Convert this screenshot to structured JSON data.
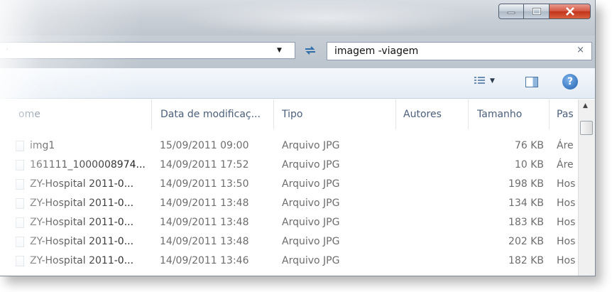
{
  "window": {
    "controls": {
      "minimize": "minimize",
      "maximize": "maximize",
      "close": "close"
    }
  },
  "address": {
    "chevron": "›",
    "dropdown": "▼"
  },
  "search": {
    "value": "imagem -viagem",
    "clear": "×"
  },
  "toolbar": {
    "views_icon": "views-icon",
    "preview_pane_icon": "preview-pane-icon",
    "help": "?"
  },
  "columns": [
    {
      "label": "ome"
    },
    {
      "label": "Data de modificaç..."
    },
    {
      "label": "Tipo"
    },
    {
      "label": "Autores"
    },
    {
      "label": "Tamanho"
    },
    {
      "label": "Pas"
    }
  ],
  "rows": [
    {
      "name": "img1",
      "date": "15/09/2011 09:00",
      "type": "Arquivo JPG",
      "size": "76 KB",
      "folder": "Áre"
    },
    {
      "name": "161111_1000008974...",
      "date": "14/09/2011 17:52",
      "type": "Arquivo JPG",
      "size": "10 KB",
      "folder": "Áre"
    },
    {
      "name": "ZY-Hospital 2011-0...",
      "date": "14/09/2011 13:50",
      "type": "Arquivo JPG",
      "size": "198 KB",
      "folder": "Hos"
    },
    {
      "name": "ZY-Hospital 2011-0...",
      "date": "14/09/2011 13:48",
      "type": "Arquivo JPG",
      "size": "134 KB",
      "folder": "Hos"
    },
    {
      "name": "ZY-Hospital 2011-0...",
      "date": "14/09/2011 13:48",
      "type": "Arquivo JPG",
      "size": "183 KB",
      "folder": "Hos"
    },
    {
      "name": "ZY-Hospital 2011-0...",
      "date": "14/09/2011 13:48",
      "type": "Arquivo JPG",
      "size": "202 KB",
      "folder": "Hos"
    },
    {
      "name": "ZY-Hospital 2011-0...",
      "date": "14/09/2011 13:46",
      "type": "Arquivo JPG",
      "size": "182 KB",
      "folder": "Hos"
    }
  ]
}
